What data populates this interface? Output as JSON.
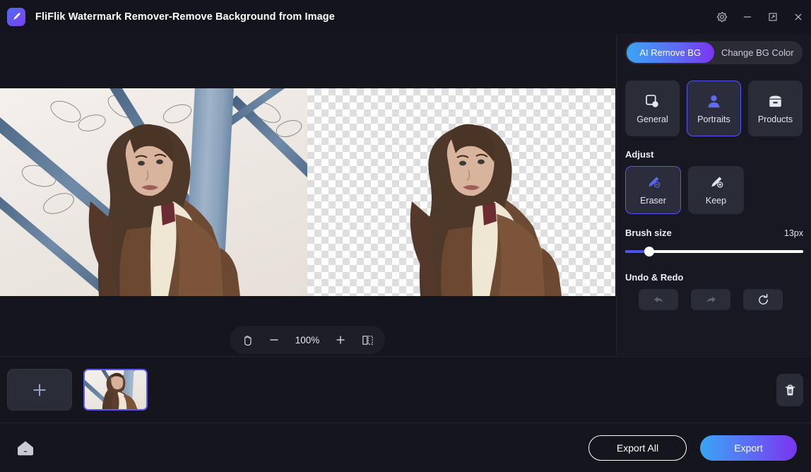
{
  "window": {
    "title": "FliFlik Watermark Remover-Remove Background from Image",
    "logo_icon": "brush-logo-icon",
    "controls": [
      {
        "name": "settings-button",
        "icon": "gear-icon"
      },
      {
        "name": "minimize-button",
        "icon": "minimize-icon"
      },
      {
        "name": "maximize-button",
        "icon": "maximize-icon"
      },
      {
        "name": "close-button",
        "icon": "close-icon"
      }
    ]
  },
  "canvas": {
    "left_pane_label": "original-image",
    "right_pane_label": "background-removed-image",
    "zoombar": {
      "pan_icon": "hand-pan-icon",
      "zoom_out_label": "−",
      "zoom_level": "100%",
      "zoom_in_label": "+",
      "compare_icon": "split-compare-icon"
    }
  },
  "panel": {
    "tabs": [
      {
        "label": "AI Remove BG",
        "active": true
      },
      {
        "label": "Change BG Color",
        "active": false
      }
    ],
    "modes": [
      {
        "label": "General",
        "icon": "general-shape-icon",
        "active": false
      },
      {
        "label": "Portraits",
        "icon": "portrait-person-icon",
        "active": true
      },
      {
        "label": "Products",
        "icon": "product-box-icon",
        "active": false
      }
    ],
    "adjust": {
      "title": "Adjust",
      "tools": [
        {
          "label": "Eraser",
          "icon": "brush-minus-icon",
          "active": true
        },
        {
          "label": "Keep",
          "icon": "brush-plus-icon",
          "active": false
        }
      ]
    },
    "brush": {
      "label": "Brush size",
      "value": "13px",
      "percent": 13.5
    },
    "undo_redo": {
      "title": "Undo & Redo",
      "buttons": [
        {
          "name": "undo-button",
          "icon": "undo-arrow-icon",
          "enabled": false
        },
        {
          "name": "redo-button",
          "icon": "redo-arrow-icon",
          "enabled": false
        },
        {
          "name": "reset-button",
          "icon": "refresh-icon",
          "enabled": true
        }
      ]
    }
  },
  "strip": {
    "add_label": "+",
    "add_name": "add-image-button",
    "thumbnail_name": "image-thumbnail",
    "delete_icon": "trash-icon"
  },
  "footer": {
    "home_icon": "home-icon",
    "export_all_label": "Export All",
    "export_label": "Export"
  },
  "colors": {
    "accent_blue": "#3aa5f5",
    "accent_purple": "#7b35f0",
    "selection_border": "#5356f5",
    "panel_bg": "#171821",
    "app_bg": "#15161d",
    "card_bg": "#2a2c37"
  }
}
